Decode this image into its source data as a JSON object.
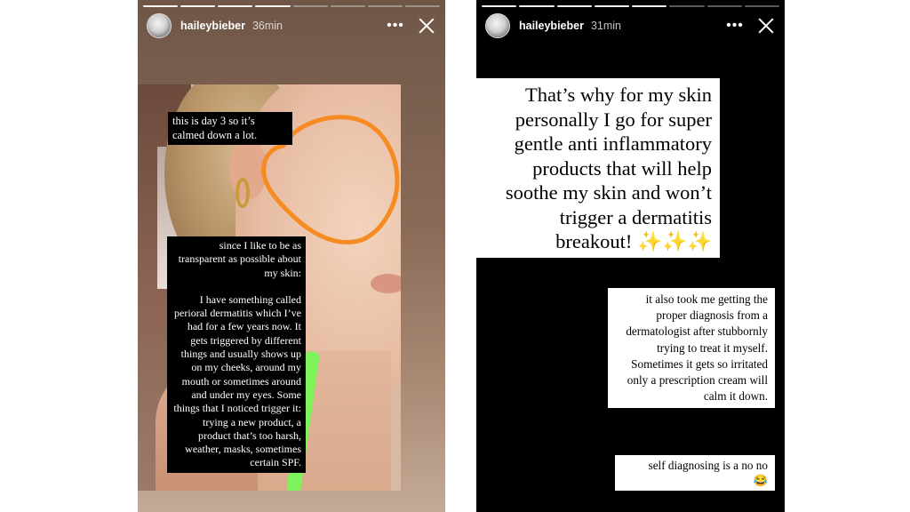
{
  "left_story": {
    "username": "haileybieber",
    "time": "36min",
    "more_label": "•••",
    "caption_top": "this is day 3 so it’s calmed down a lot.",
    "caption_main_p1": "since I like to be as transparent as possible about my skin:",
    "caption_main_p2": "I have something called perioral dermatitis which I’ve had for a few years now. It gets triggered by different things and usually shows up on my cheeks, around my mouth or sometimes around and under my eyes. Some things that I noticed trigger it: trying a new product, a product that’s too harsh, weather, masks, sometimes certain SPF.",
    "annotation_color": "#f68b24"
  },
  "right_story": {
    "username": "haileybieber",
    "time": "31min",
    "more_label": "•••",
    "caption_large": "That’s why for my skin personally I go for super gentle anti inflammatory products that will help soothe my skin and won’t trigger a dermatitis breakout!",
    "caption_large_emoji": "✨✨✨",
    "caption_mid": "it also took me getting the proper diagnosis from a dermatologist after stubbornly trying to treat it myself. Sometimes it gets so irritated only a prescription cream will calm it down.",
    "caption_bottom": "self diagnosing is a no no",
    "caption_bottom_emoji": "😂"
  }
}
